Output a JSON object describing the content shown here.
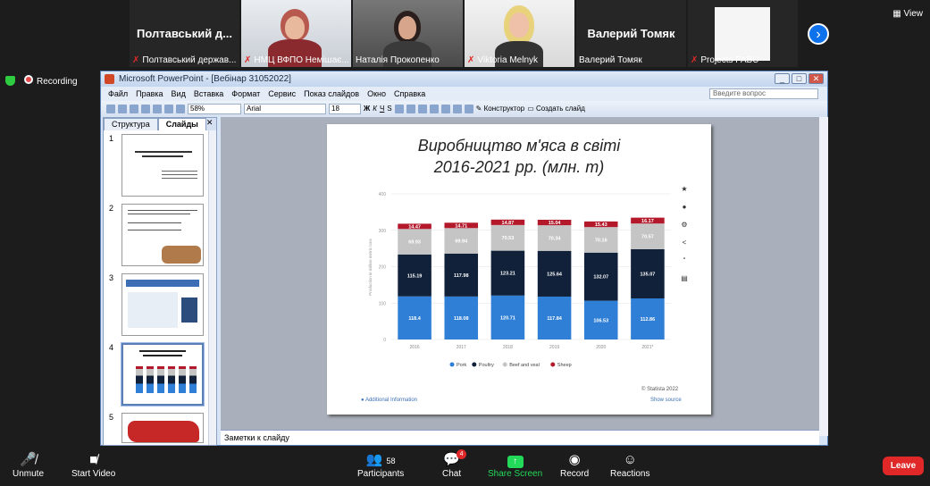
{
  "participants": [
    {
      "name": "Полтавський д...",
      "label": "Полтавський держав..."
    },
    {
      "name": "",
      "label": "НМЦ ВФПО Немішає..."
    },
    {
      "name": "",
      "label": "Наталія Прокопенко"
    },
    {
      "name": "",
      "label": "Viktoria Melnyk"
    },
    {
      "name": "Валерий Томяк",
      "label": "Валерий Томяк"
    },
    {
      "name": "",
      "label": "Projects FABU"
    }
  ],
  "view_label": "View",
  "recording_label": "Recording",
  "ppt": {
    "title": "Microsoft PowerPoint - [Вебінар 31052022]",
    "menu": [
      "Файл",
      "Правка",
      "Вид",
      "Вставка",
      "Формат",
      "Сервис",
      "Показ слайдов",
      "Окно",
      "Справка"
    ],
    "ask_placeholder": "Введите вопрос",
    "zoom": "58%",
    "font": "Arial",
    "size": "18",
    "designer": "Конструктор",
    "new_slide": "Создать слайд",
    "tab_outline": "Структура",
    "tab_slides": "Слайды",
    "notes_label": "Заметки к слайду",
    "slide_numbers": [
      "1",
      "2",
      "3",
      "4",
      "5"
    ]
  },
  "slide": {
    "title_line1": "Виробництво м'яса в світі",
    "title_line2": "2016-2021 рр. (млн. т)",
    "footer_left": "Additional Information",
    "footer_right1": "© Statista 2022",
    "footer_right2": "Show source"
  },
  "chart_data": {
    "type": "bar",
    "stacked": true,
    "categories": [
      "2016",
      "2017",
      "2018",
      "2019",
      "2020",
      "2021*"
    ],
    "ylabel": "Production in million metric tons",
    "ylim": [
      0,
      400
    ],
    "yticks": [
      "0",
      "100",
      "200",
      "300",
      "400"
    ],
    "series": [
      {
        "name": "Pork",
        "color": "#2f7fd6",
        "values": [
          118.4,
          118.08,
          120.71,
          117.84,
          106.53,
          112.86
        ]
      },
      {
        "name": "Poultry",
        "color": "#11213a",
        "values": [
          115.19,
          117.98,
          123.21,
          125.64,
          132.07,
          135.07
        ]
      },
      {
        "name": "Beef and veal",
        "color": "#c5c5c5",
        "values": [
          69.93,
          69.94,
          70.53,
          70.34,
          70.16,
          70.57
        ]
      },
      {
        "name": "Sheep",
        "color": "#b3192b",
        "values": [
          14.47,
          14.71,
          14.87,
          15.04,
          15.43,
          16.17
        ]
      }
    ]
  },
  "bottom": {
    "unmute": "Unmute",
    "start_video": "Start Video",
    "participants": "Participants",
    "participants_count": "58",
    "chat": "Chat",
    "chat_badge": "4",
    "share": "Share Screen",
    "record": "Record",
    "reactions": "Reactions",
    "leave": "Leave"
  },
  "colors": {
    "share_green": "#23d959",
    "leave_red": "#e02828",
    "zoom_blue": "#0e72ed"
  }
}
